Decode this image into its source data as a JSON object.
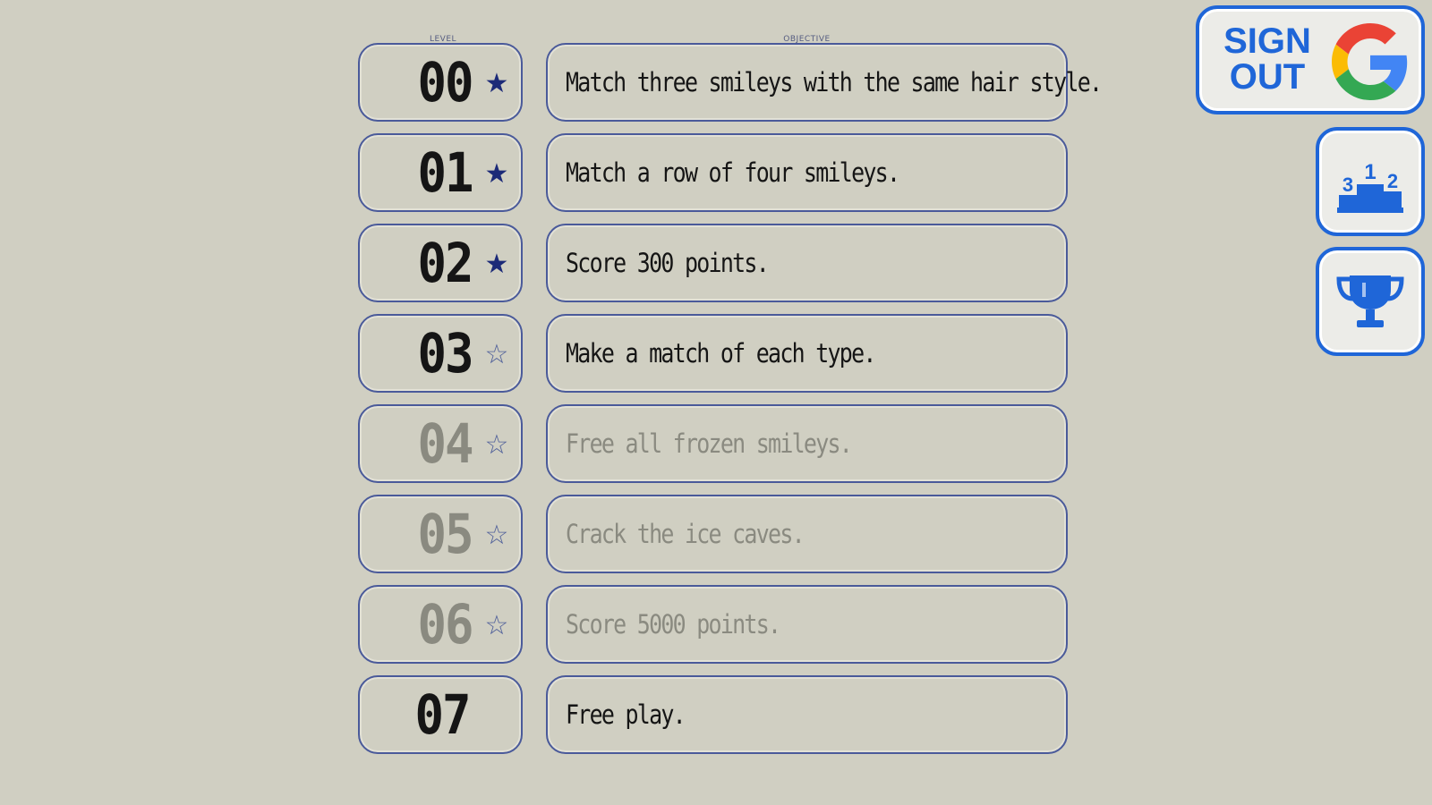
{
  "captions": {
    "level": "LEVEL",
    "objective": "OBJECTIVE"
  },
  "levels": [
    {
      "number": "00",
      "objective": "Match three smileys with the same hair style.",
      "star": "★",
      "completed": true,
      "locked": false
    },
    {
      "number": "01",
      "objective": "Match a row of four smileys.",
      "star": "★",
      "completed": true,
      "locked": false
    },
    {
      "number": "02",
      "objective": "Score 300 points.",
      "star": "★",
      "completed": true,
      "locked": false
    },
    {
      "number": "03",
      "objective": "Make a match of each type.",
      "star": "☆",
      "completed": false,
      "locked": false
    },
    {
      "number": "04",
      "objective": "Free all frozen smileys.",
      "star": "☆",
      "completed": false,
      "locked": true
    },
    {
      "number": "05",
      "objective": "Crack the ice caves.",
      "star": "☆",
      "completed": false,
      "locked": true
    },
    {
      "number": "06",
      "objective": "Score 5000 points.",
      "star": "☆",
      "completed": false,
      "locked": true
    },
    {
      "number": "07",
      "objective": "Free play.",
      "star": "",
      "completed": false,
      "locked": false
    }
  ],
  "account": {
    "sign_out_line1": "SIGN",
    "sign_out_line2": "OUT",
    "provider_icon": "google-g-icon"
  },
  "leaderboard": {
    "icon": "podium-icon",
    "podium_labels": [
      "3",
      "1",
      "2"
    ]
  },
  "achievements": {
    "icon": "trophy-icon"
  },
  "colors": {
    "background": "#d0cfc2",
    "border": "#4a5a9a",
    "star": "#1c2a78",
    "locked_text": "#8a8a80",
    "accent_blue": "#1f66d8"
  }
}
